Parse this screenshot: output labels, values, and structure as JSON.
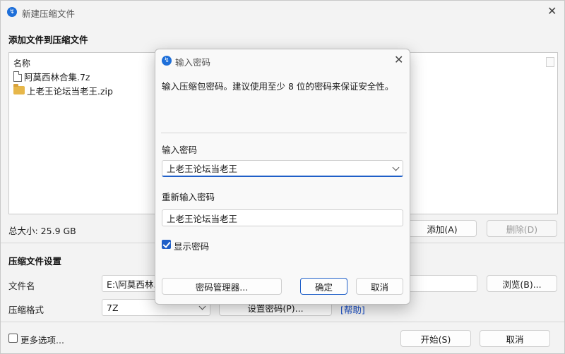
{
  "main": {
    "title": "新建压缩文件",
    "add_heading": "添加文件到压缩文件",
    "list_header": "名称",
    "files": [
      {
        "name": "阿莫西林合集.7z",
        "icon": "document-icon"
      },
      {
        "name": "上老王论坛当老王.zip",
        "icon": "folder-icon"
      }
    ],
    "total_size": "总大小: 25.9 GB",
    "add_button": "添加(A)",
    "remove_button": "删除(D)",
    "settings_heading": "压缩文件设置",
    "filename_label": "文件名",
    "filename_value": "E:\\阿莫西林.7",
    "browse_button": "浏览(B)...",
    "format_label": "压缩格式",
    "format_value": "7Z",
    "set_password_button": "设置密码(P)...",
    "help_link": "[帮助]",
    "more_options_label": "更多选项...",
    "more_options_checked": false,
    "start_button": "开始(S)",
    "cancel_button": "取消"
  },
  "dialog": {
    "title": "输入密码",
    "description": "输入压缩包密码。建议使用至少 8 位的密码来保证安全性。",
    "password_label": "输入密码",
    "password_value": "上老王论坛当老王",
    "reenter_label": "重新输入密码",
    "reenter_value": "上老王论坛当老王",
    "show_password_label": "显示密码",
    "show_password_checked": true,
    "manager_button": "密码管理器...",
    "ok_button": "确定",
    "cancel_button": "取消"
  },
  "colors": {
    "accent": "#1f5fc8",
    "app_icon": "#1e6fd9",
    "link": "#1a4fc7"
  }
}
